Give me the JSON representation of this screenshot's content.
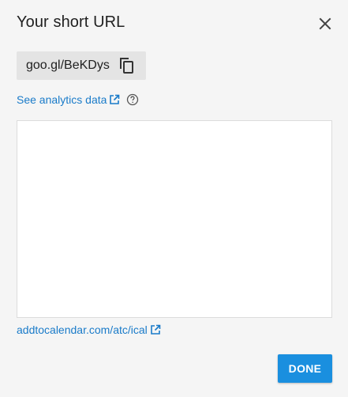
{
  "dialog": {
    "title": "Your short URL",
    "close_icon": "close-icon",
    "short_url": "goo.gl/BeKDys",
    "copy_icon": "copy-icon",
    "analytics_link": "See analytics data",
    "analytics_link_icon": "external-link-icon",
    "help_icon": "help-circle-icon",
    "target_link": "addtocalendar.com/atc/ical",
    "target_link_icon": "external-link-icon",
    "done_label": "DONE"
  },
  "colors": {
    "background": "#f5f5f5",
    "chip": "#e4e4e4",
    "link": "#1a7bc9",
    "primary_button": "#1a8fdf"
  }
}
